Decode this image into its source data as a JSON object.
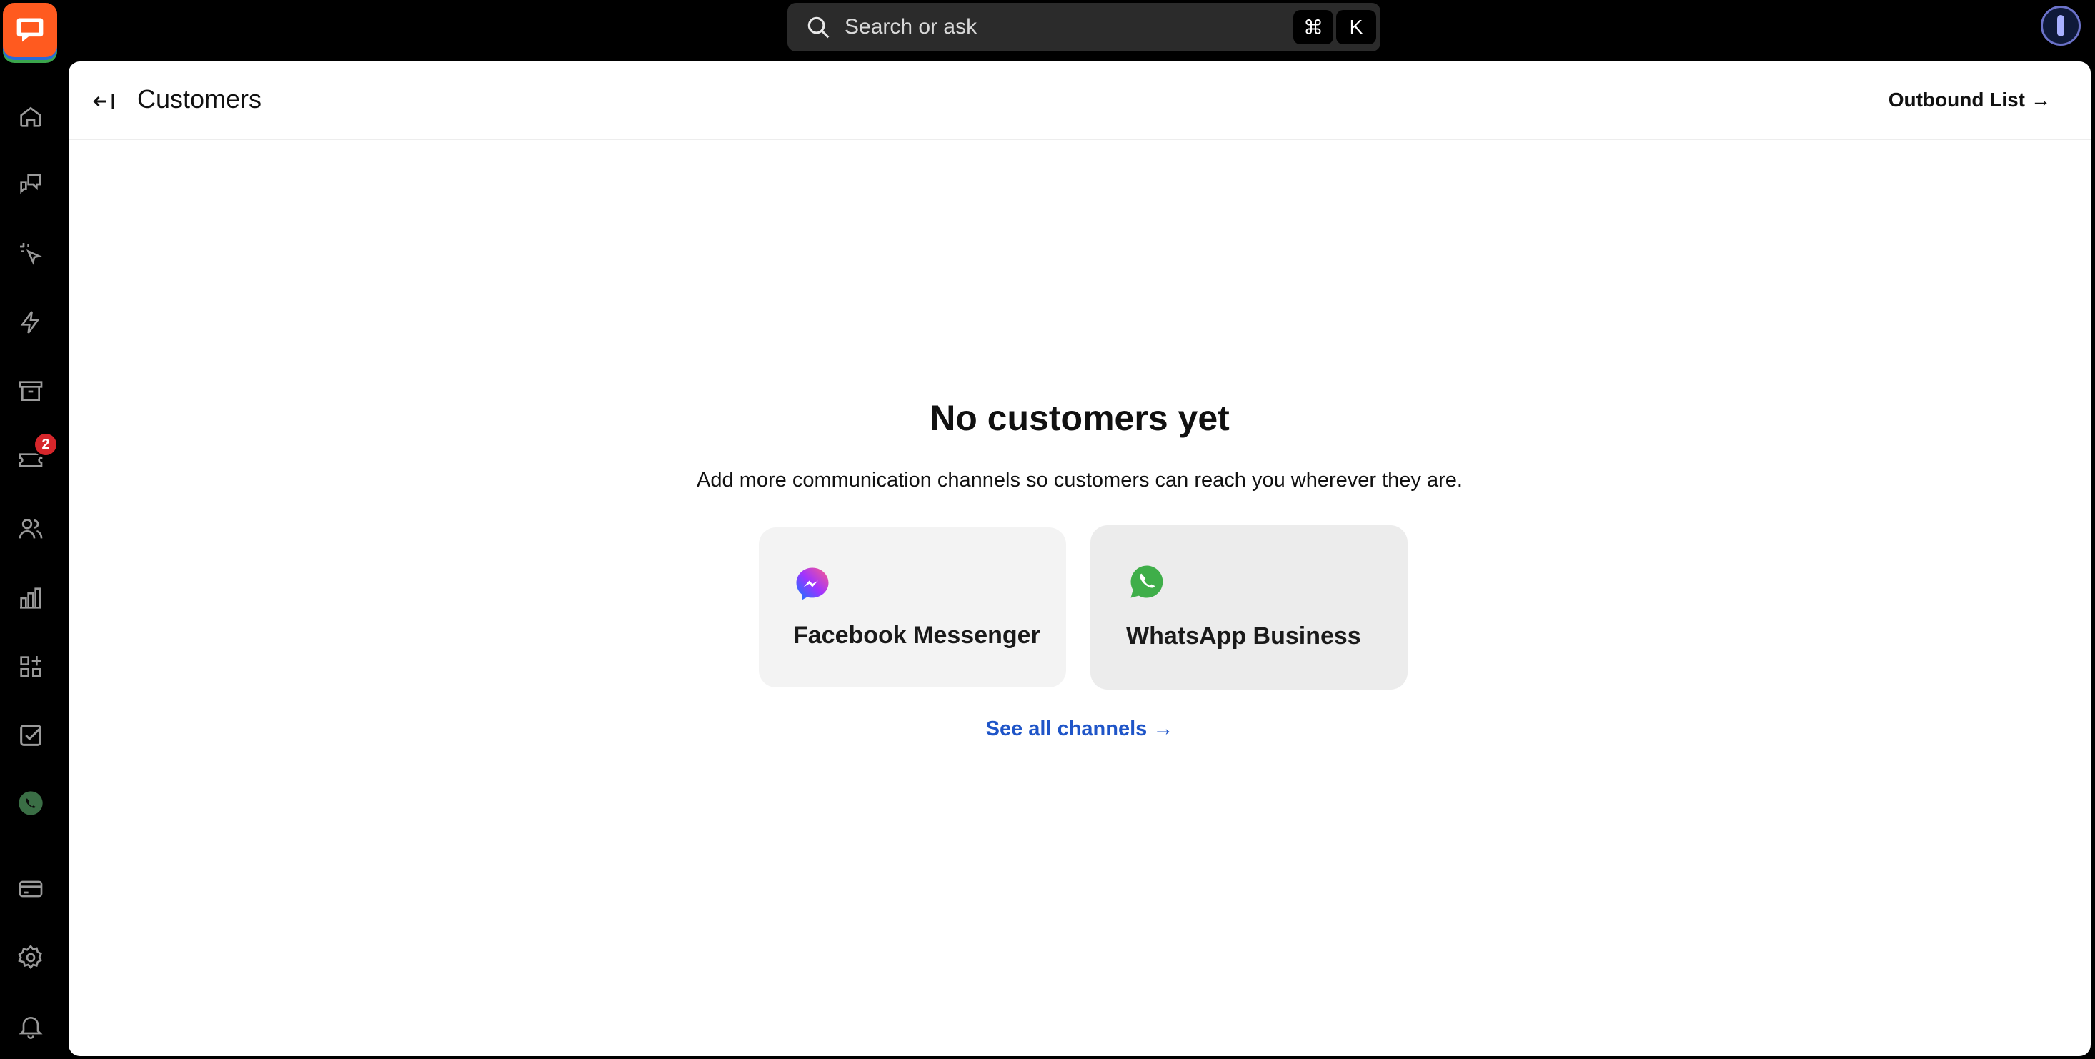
{
  "topbar": {
    "search_placeholder": "Search or ask",
    "shortcut_cmd": "⌘",
    "shortcut_key": "K"
  },
  "sidebar": {
    "items": [
      {
        "name": "home",
        "icon": "home-icon"
      },
      {
        "name": "chats",
        "icon": "chats-icon"
      },
      {
        "name": "engage",
        "icon": "sparkle-cursor-icon"
      },
      {
        "name": "automation",
        "icon": "lightning-icon"
      },
      {
        "name": "archives",
        "icon": "archive-icon"
      },
      {
        "name": "tickets",
        "icon": "ticket-icon",
        "badge": "2"
      },
      {
        "name": "customers",
        "icon": "users-icon"
      },
      {
        "name": "reports",
        "icon": "bar-chart-icon"
      },
      {
        "name": "apps",
        "icon": "apps-icon"
      },
      {
        "name": "tasks",
        "icon": "checklist-icon"
      },
      {
        "name": "whatsapp",
        "icon": "whatsapp-icon"
      },
      {
        "name": "billing",
        "icon": "credit-card-icon"
      },
      {
        "name": "settings",
        "icon": "gear-icon"
      },
      {
        "name": "notifications",
        "icon": "bell-icon"
      }
    ],
    "tickets_badge": "2"
  },
  "header": {
    "title": "Customers",
    "outbound_label": "Outbound List",
    "outbound_arrow": "→"
  },
  "empty_state": {
    "title": "No customers yet",
    "subtitle": "Add more communication channels so customers can reach you wherever they are.",
    "channels": [
      {
        "label": "Facebook Messenger",
        "icon": "messenger-icon"
      },
      {
        "label": "WhatsApp Business",
        "icon": "whatsapp-icon"
      }
    ],
    "see_all_label": "See all channels →"
  },
  "colors": {
    "brand": "#ff5a1f",
    "link": "#1f55c8",
    "badge": "#d6262b",
    "whatsapp": "#3fae49"
  }
}
